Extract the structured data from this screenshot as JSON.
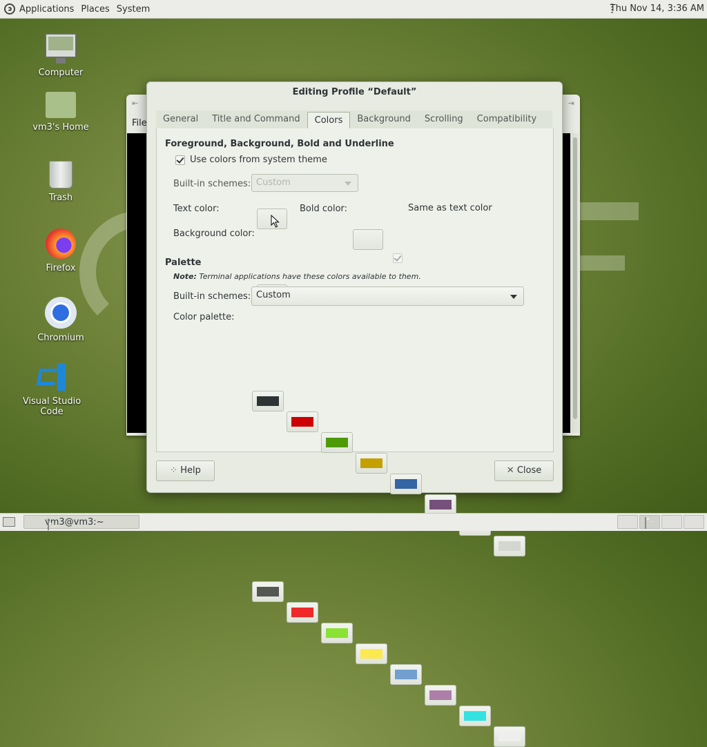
{
  "top_panel": {
    "menus": [
      "Applications",
      "Places",
      "System"
    ],
    "clock": "Thu Nov 14,  3:36 AM"
  },
  "desktop": {
    "icons": [
      {
        "label": "Computer",
        "icon": "computer-icon"
      },
      {
        "label": "vm3's Home",
        "icon": "home-folder-icon"
      },
      {
        "label": "Trash",
        "icon": "trash-icon"
      },
      {
        "label": "Firefox",
        "icon": "firefox-icon"
      },
      {
        "label": "Chromium",
        "icon": "chromium-icon"
      },
      {
        "label": "Visual Studio Code",
        "icon": "vscode-icon"
      }
    ]
  },
  "terminal_window": {
    "menu_first": "File"
  },
  "dialog": {
    "title": "Editing Profile “Default”",
    "tabs": [
      "General",
      "Title and Command",
      "Colors",
      "Background",
      "Scrolling",
      "Compatibility"
    ],
    "active_tab": "Colors",
    "fg_section": {
      "heading": "Foreground, Background, Bold and Underline",
      "use_system_theme_label": "Use colors from system theme",
      "use_system_theme_checked": true,
      "builtin_label": "Built-in schemes:",
      "builtin_value": "Custom",
      "text_color_label": "Text color:",
      "bold_color_label": "Bold color:",
      "same_as_text_label": "Same as text color",
      "same_as_text_checked": true,
      "background_color_label": "Background color:",
      "background_color": "#ffffdd"
    },
    "palette_section": {
      "heading": "Palette",
      "note_bold": "Note:",
      "note_text": " Terminal applications have these colors available to them.",
      "builtin_label": "Built-in schemes:",
      "builtin_value": "Custom",
      "color_palette_label": "Color palette:",
      "row1": [
        "#2e3436",
        "#cc0000",
        "#4e9a06",
        "#c4a000",
        "#3465a4",
        "#75507b",
        "#06989a",
        "#d3d7cf"
      ],
      "row2": [
        "#555753",
        "#ef2929",
        "#8ae234",
        "#fce94f",
        "#729fcf",
        "#ad7fa8",
        "#34e2e2",
        "#eeeeec"
      ]
    },
    "help_label": "Help",
    "close_label": "Close"
  },
  "bottom_panel": {
    "task_label": "vm3@vm3:~"
  }
}
